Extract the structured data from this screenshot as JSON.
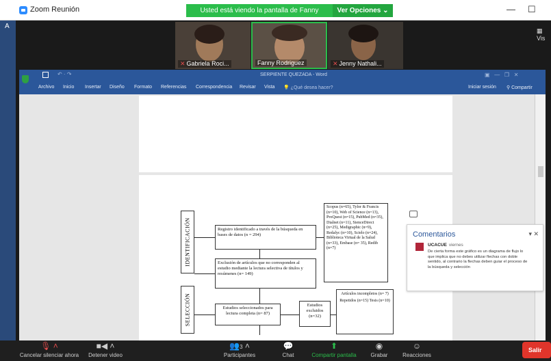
{
  "window": {
    "app_title": "Zoom Reunión",
    "minimize": "—",
    "maximize": "☐",
    "close": "✕"
  },
  "sharing_banner": {
    "text": "Usted está viendo la pantalla de Fanny Rodríguez",
    "view_options": "Ver Opciones ⌄"
  },
  "left_edge_label": "A",
  "right_edge_label": "▦ Vis",
  "participants_strip": [
    {
      "name": "Gabriela Roci..."
    },
    {
      "name": "Fanny Rodriguez"
    },
    {
      "name": "Jenny Nathali..."
    }
  ],
  "word": {
    "doc_title": "SERPIENTE QUEZADA - Word",
    "menu": [
      "Archivo",
      "Inicio",
      "Insertar",
      "Diseño",
      "Formato",
      "Referencias",
      "Correspondencia",
      "Revisar",
      "Vista"
    ],
    "tell_me": "¿Qué desea hacer?",
    "sign_in": "Iniciar sesión",
    "share": "Compartir"
  },
  "flowchart": {
    "label_identificacion": "IDENTIFICACIÓN",
    "label_seleccion": "SELECCIÓN",
    "box_registro": "Registro identificado a través de la búsqueda en bases de datos (n = 294)",
    "box_exclusion": "Exclusión de artículos que no corresponden al estudio mediante la lectura selectiva de títulos y resúmenes (n= 149)",
    "box_estudios": "Estudios seleccionados para lectura completa (n= 87)",
    "box_excluidos": "Estudios excluidos (n=32)",
    "box_sources": "Scopus (n=65), Tylor & Francis (n=10), Web of Science (n=13), ProQuest (n=15), PubMed (n=35), Dialnet (n=11), SienceDirect (n=25), Medigraphic (n=9), Redalyc (n=10), Scielo (n=24), Biblioteca Virtual de la Salud (n=33), Embase (n= 35), Redib (n=7)",
    "box_motivos": "Artículos incompletos (n= 7) Repetidos (n=15) Tesis (n=10)"
  },
  "comments_panel": {
    "title": "Comentarios",
    "controls": "▾ ✕",
    "author": "UCACUE",
    "date": "viernes",
    "text": "De cierta forma este gráfico es un diagrama de flujo lo que implica que no debes utilizar flechas con doble sentido, al contrario la flechas deben guiar el proceso de la búsqueda y selección"
  },
  "toolbar": {
    "mute": "Cancelar silenciar ahora",
    "video": "Detener video",
    "participants": "Participantes",
    "participants_count": "3",
    "chat": "Chat",
    "share": "Compartir pantalla",
    "record": "Grabar",
    "reactions": "Reacciones",
    "leave": "Salir"
  },
  "colors": {
    "word_blue": "#2b579a",
    "zoom_green": "#2bbd4b",
    "leave_red": "#e0352b"
  }
}
